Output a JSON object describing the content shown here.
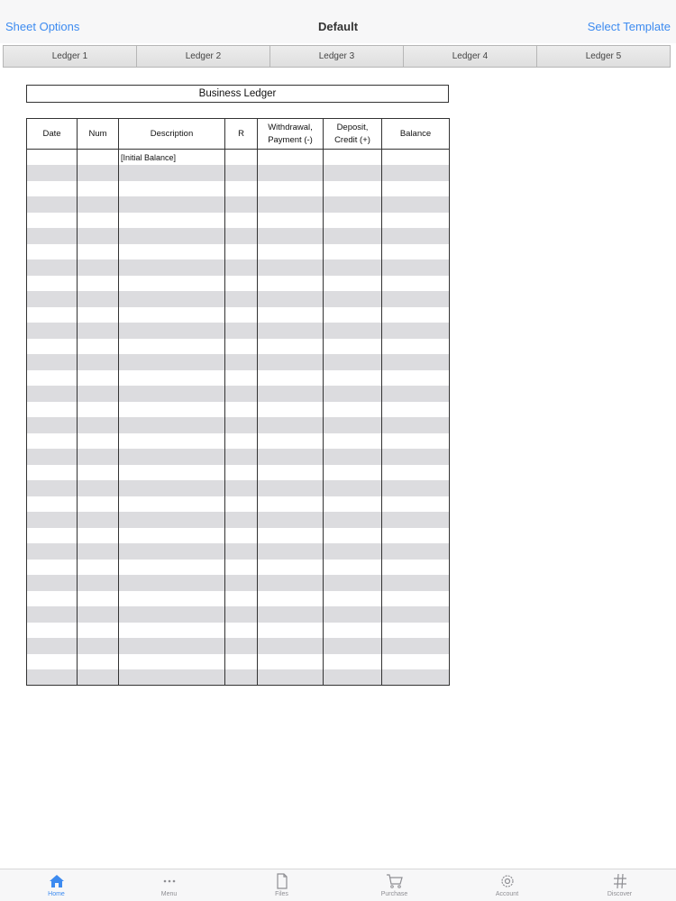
{
  "nav": {
    "left": "Sheet Options",
    "title": "Default",
    "right": "Select Template"
  },
  "tabs": [
    "Ledger 1",
    "Ledger 2",
    "Ledger 3",
    "Ledger 4",
    "Ledger 5"
  ],
  "sheet": {
    "title": "Business Ledger",
    "columns": [
      {
        "line1": "Date",
        "line2": ""
      },
      {
        "line1": "Num",
        "line2": ""
      },
      {
        "line1": "Description",
        "line2": ""
      },
      {
        "line1": "R",
        "line2": ""
      },
      {
        "line1": "Withdrawal,",
        "line2": "Payment (-)"
      },
      {
        "line1": "Deposit,",
        "line2": "Credit (+)"
      },
      {
        "line1": "Balance",
        "line2": ""
      }
    ],
    "rows": [
      [
        "",
        "",
        "[Initial Balance]",
        "",
        "",
        "",
        ""
      ],
      [
        "",
        "",
        "",
        "",
        "",
        "",
        ""
      ],
      [
        "",
        "",
        "",
        "",
        "",
        "",
        ""
      ],
      [
        "",
        "",
        "",
        "",
        "",
        "",
        ""
      ],
      [
        "",
        "",
        "",
        "",
        "",
        "",
        ""
      ],
      [
        "",
        "",
        "",
        "",
        "",
        "",
        ""
      ],
      [
        "",
        "",
        "",
        "",
        "",
        "",
        ""
      ],
      [
        "",
        "",
        "",
        "",
        "",
        "",
        ""
      ],
      [
        "",
        "",
        "",
        "",
        "",
        "",
        ""
      ],
      [
        "",
        "",
        "",
        "",
        "",
        "",
        ""
      ],
      [
        "",
        "",
        "",
        "",
        "",
        "",
        ""
      ],
      [
        "",
        "",
        "",
        "",
        "",
        "",
        ""
      ],
      [
        "",
        "",
        "",
        "",
        "",
        "",
        ""
      ],
      [
        "",
        "",
        "",
        "",
        "",
        "",
        ""
      ],
      [
        "",
        "",
        "",
        "",
        "",
        "",
        ""
      ],
      [
        "",
        "",
        "",
        "",
        "",
        "",
        ""
      ],
      [
        "",
        "",
        "",
        "",
        "",
        "",
        ""
      ],
      [
        "",
        "",
        "",
        "",
        "",
        "",
        ""
      ],
      [
        "",
        "",
        "",
        "",
        "",
        "",
        ""
      ],
      [
        "",
        "",
        "",
        "",
        "",
        "",
        ""
      ],
      [
        "",
        "",
        "",
        "",
        "",
        "",
        ""
      ],
      [
        "",
        "",
        "",
        "",
        "",
        "",
        ""
      ],
      [
        "",
        "",
        "",
        "",
        "",
        "",
        ""
      ],
      [
        "",
        "",
        "",
        "",
        "",
        "",
        ""
      ],
      [
        "",
        "",
        "",
        "",
        "",
        "",
        ""
      ],
      [
        "",
        "",
        "",
        "",
        "",
        "",
        ""
      ],
      [
        "",
        "",
        "",
        "",
        "",
        "",
        ""
      ],
      [
        "",
        "",
        "",
        "",
        "",
        "",
        ""
      ],
      [
        "",
        "",
        "",
        "",
        "",
        "",
        ""
      ],
      [
        "",
        "",
        "",
        "",
        "",
        "",
        ""
      ],
      [
        "",
        "",
        "",
        "",
        "",
        "",
        ""
      ],
      [
        "",
        "",
        "",
        "",
        "",
        "",
        ""
      ],
      [
        "",
        "",
        "",
        "",
        "",
        "",
        ""
      ],
      [
        "",
        "",
        "",
        "",
        "",
        "",
        ""
      ]
    ]
  },
  "tabbar": [
    {
      "label": "Home",
      "icon": "home-icon",
      "active": true
    },
    {
      "label": "Menu",
      "icon": "more-icon",
      "active": false
    },
    {
      "label": "Files",
      "icon": "file-icon",
      "active": false
    },
    {
      "label": "Purchase",
      "icon": "cart-icon",
      "active": false
    },
    {
      "label": "Account",
      "icon": "gear-icon",
      "active": false
    },
    {
      "label": "Discover",
      "icon": "hashtag-icon",
      "active": false
    }
  ],
  "colors": {
    "accent": "#3d8bf0",
    "stripe": "#dcdcdf",
    "inactive": "#8e8e93"
  }
}
